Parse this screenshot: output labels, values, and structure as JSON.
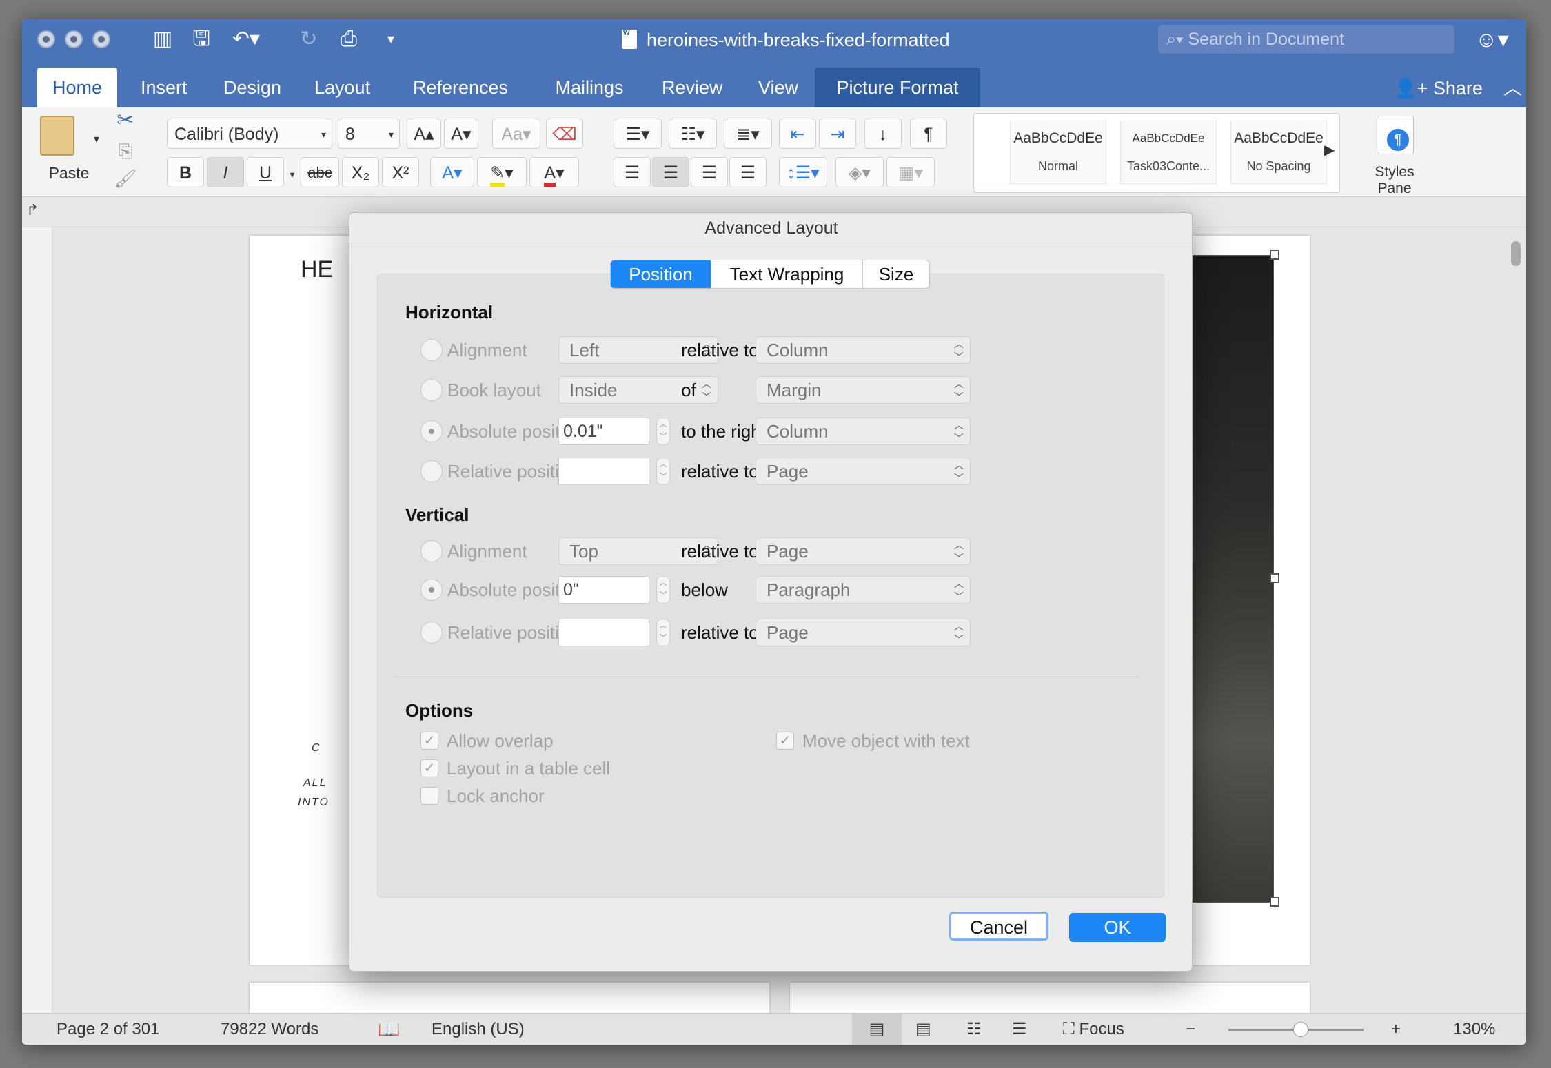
{
  "window": {
    "title": "heroines-with-breaks-fixed-formatted"
  },
  "search": {
    "placeholder": "Search in Document"
  },
  "tabs": [
    "Home",
    "Insert",
    "Design",
    "Layout",
    "References",
    "Mailings",
    "Review",
    "View",
    "Picture Format"
  ],
  "share_label": "Share",
  "ribbon": {
    "paste_label": "Paste",
    "font_name": "Calibri (Body)",
    "font_size": "8",
    "strike_label": "abc",
    "styles": [
      {
        "preview": "AaBbCcDdEe",
        "name": "Normal"
      },
      {
        "preview": "AaBbCcDdEe",
        "name": "Task03Conte..."
      },
      {
        "preview": "AaBbCcDdEe",
        "name": "No Spacing"
      }
    ],
    "styles_pane_label": "Styles Pane"
  },
  "doc": {
    "heading_fragment": "HE",
    "frag_c": "C",
    "frag_all": "ALL",
    "frag_into": "INTO"
  },
  "dialog": {
    "title": "Advanced Layout",
    "tabs": [
      "Position",
      "Text Wrapping",
      "Size"
    ],
    "horizontal": {
      "title": "Horizontal",
      "rows": [
        {
          "label": "Alignment",
          "value": "Left",
          "relation": "relative to",
          "target": "Column"
        },
        {
          "label": "Book layout",
          "value": "Inside",
          "relation": "of",
          "target": "Margin"
        },
        {
          "label": "Absolute position",
          "value": "0.01\"",
          "relation": "to the right of",
          "target": "Column"
        },
        {
          "label": "Relative position",
          "value": "",
          "relation": "relative to",
          "target": "Page"
        }
      ]
    },
    "vertical": {
      "title": "Vertical",
      "rows": [
        {
          "label": "Alignment",
          "value": "Top",
          "relation": "relative to",
          "target": "Page"
        },
        {
          "label": "Absolute position",
          "value": "0\"",
          "relation": "below",
          "target": "Paragraph"
        },
        {
          "label": "Relative position",
          "value": "",
          "relation": "relative to",
          "target": "Page"
        }
      ]
    },
    "options": {
      "title": "Options",
      "allow_overlap": "Allow overlap",
      "layout_in_table_cell": "Layout in a table cell",
      "lock_anchor": "Lock anchor",
      "move_with_text": "Move object with text"
    },
    "cancel_label": "Cancel",
    "ok_label": "OK"
  },
  "status": {
    "page": "Page 2 of 301",
    "words": "79822 Words",
    "language": "English (US)",
    "focus": "Focus",
    "zoom": "130%"
  }
}
